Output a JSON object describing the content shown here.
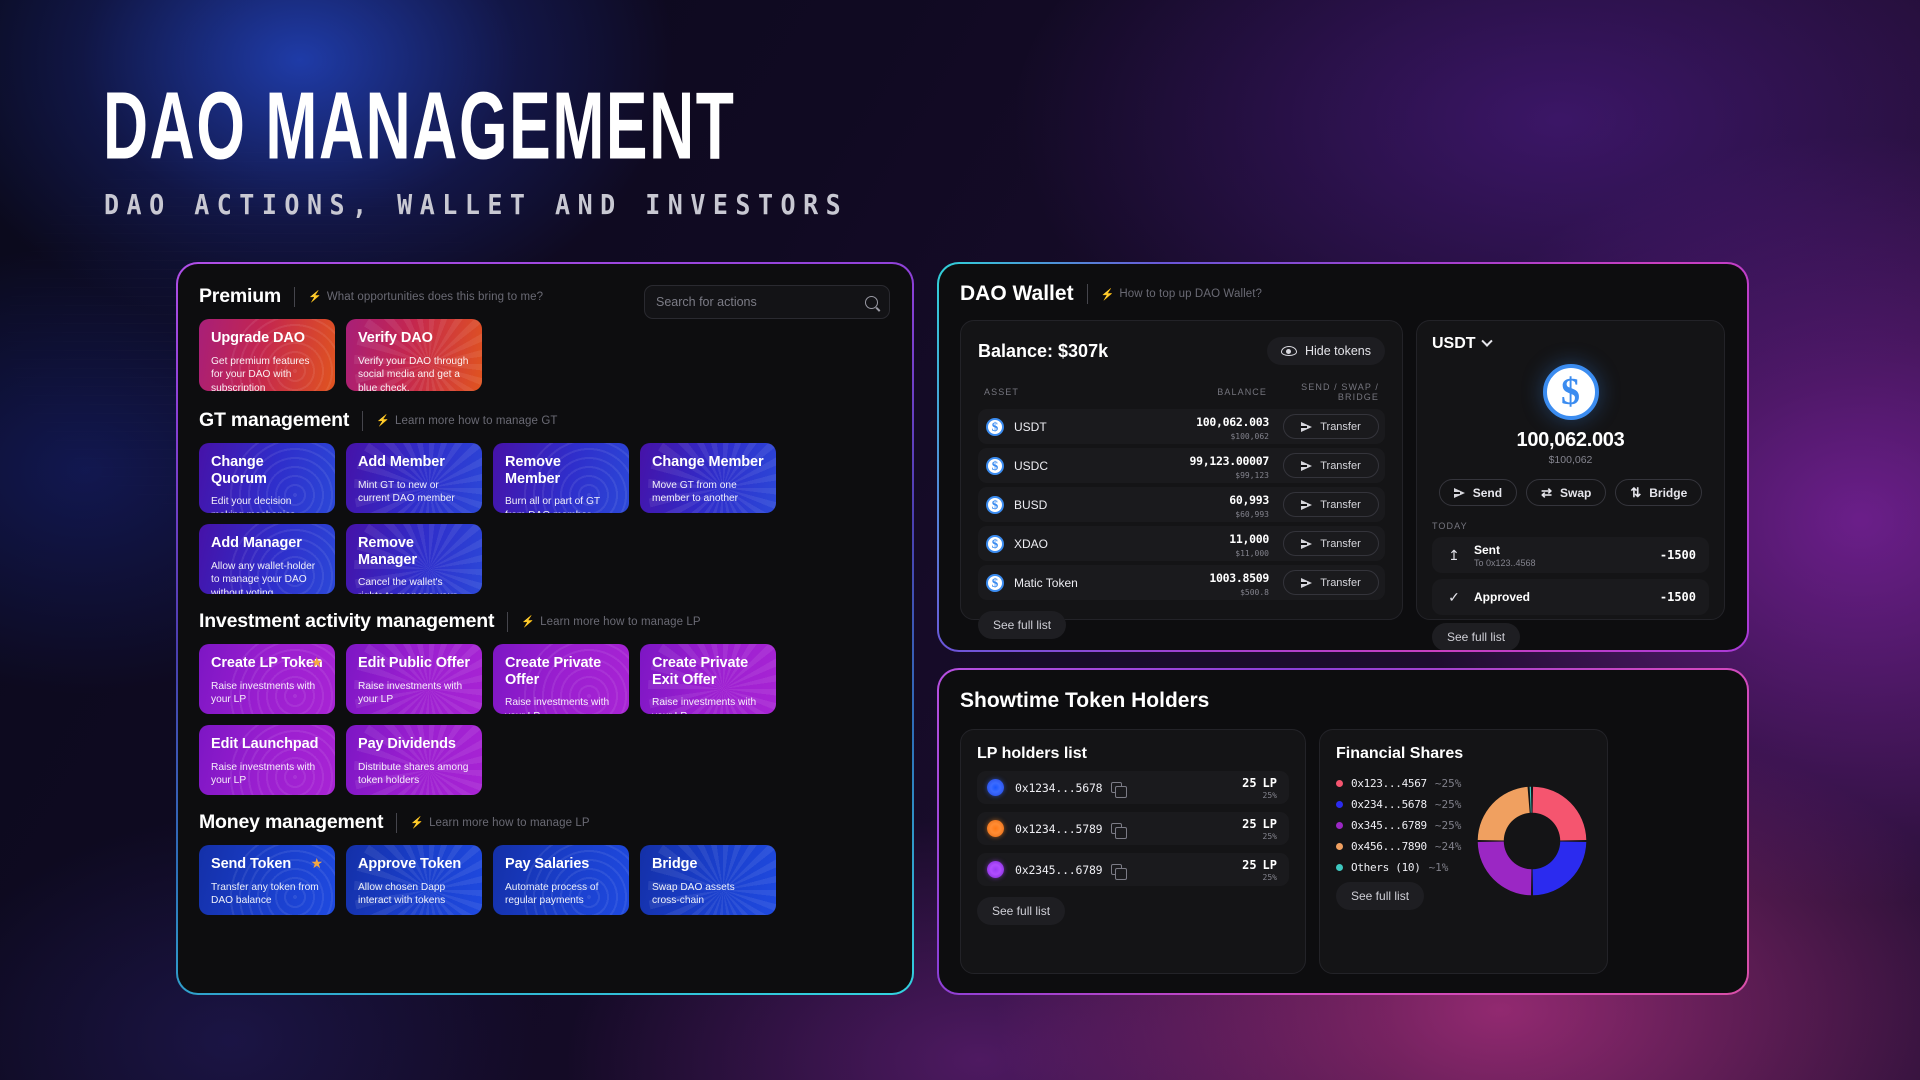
{
  "header": {
    "title": "DAO MANAGEMENT",
    "subtitle": "DAO ACTIONS, WALLET AND INVESTORS"
  },
  "search": {
    "placeholder": "Search for actions"
  },
  "left_panel": {
    "sections": [
      {
        "title": "Premium",
        "hint": "What opportunities does this bring to me?",
        "style": "premium",
        "cards": [
          {
            "title": "Upgrade DAO",
            "desc": "Get premium features for your DAO with subscription",
            "star": false
          },
          {
            "title": "Verify DAO",
            "desc": "Verify your DAO through social media and get a blue check.",
            "star": false
          }
        ]
      },
      {
        "title": "GT management",
        "hint": "Learn more how to manage GT",
        "style": "gt",
        "cards": [
          {
            "title": "Change Quorum",
            "desc": "Edit your decision making mechanics",
            "star": false
          },
          {
            "title": "Add Member",
            "desc": "Mint GT to new or current DAO member",
            "star": false
          },
          {
            "title": "Remove Member",
            "desc": "Burn all or part of GT from DAO member",
            "star": false
          },
          {
            "title": "Change Member",
            "desc": "Move GT from one member to another",
            "star": false
          },
          {
            "title": "Add Manager",
            "desc": "Allow any wallet-holder to manage your DAO without voting",
            "star": false
          },
          {
            "title": "Remove Manager",
            "desc": "Cancel the wallet's rights to manage your DAO",
            "star": false
          }
        ]
      },
      {
        "title": "Investment activity management",
        "hint": "Learn more how to manage LP",
        "style": "inv",
        "cards": [
          {
            "title": "Create LP Token",
            "desc": "Raise investments with your LP",
            "star": true
          },
          {
            "title": "Edit Public Offer",
            "desc": "Raise investments with your LP",
            "star": false
          },
          {
            "title": "Create Private Offer",
            "desc": "Raise investments with your LP",
            "star": false
          },
          {
            "title": "Create Private Exit Offer",
            "desc": "Raise investments with your LP",
            "star": false
          },
          {
            "title": "Edit Launchpad",
            "desc": "Raise investments with your LP",
            "star": false
          },
          {
            "title": "Pay Dividends",
            "desc": "Distribute shares among token holders",
            "star": false
          }
        ]
      },
      {
        "title": "Money management",
        "hint": "Learn more how to manage LP",
        "style": "money",
        "cards": [
          {
            "title": "Send Token",
            "desc": "Transfer any token from DAO balance",
            "star": true
          },
          {
            "title": "Approve Token",
            "desc": "Allow chosen Dapp interact with tokens",
            "star": false
          },
          {
            "title": "Pay Salaries",
            "desc": "Automate process of regular payments",
            "star": false
          },
          {
            "title": "Bridge",
            "desc": "Swap DAO assets cross-chain",
            "star": false
          }
        ]
      }
    ]
  },
  "wallet": {
    "title": "DAO Wallet",
    "hint": "How to top up DAO Wallet?",
    "balance_label": "Balance: $307k",
    "hide_tokens_label": "Hide tokens",
    "columns": {
      "asset": "ASSET",
      "balance": "BALANCE",
      "action": "SEND / SWAP / BRIDGE"
    },
    "transfer_label": "Transfer",
    "see_full_list": "See full list",
    "assets": [
      {
        "name": "USDT",
        "amount": "100,062.003",
        "usd": "$100,062"
      },
      {
        "name": "USDC",
        "amount": "99,123.00007",
        "usd": "$99,123"
      },
      {
        "name": "BUSD",
        "amount": "60,993",
        "usd": "$60,993"
      },
      {
        "name": "XDAO",
        "amount": "11,000",
        "usd": "$11,000"
      },
      {
        "name": "Matic Token",
        "amount": "1003.8509",
        "usd": "$500.8"
      }
    ],
    "detail": {
      "selected_token": "USDT",
      "amount": "100,062.003",
      "usd": "$100,062",
      "buttons": {
        "send": "Send",
        "swap": "Swap",
        "bridge": "Bridge"
      },
      "today_label": "TODAY",
      "see_full_list": "See full list",
      "transactions": [
        {
          "icon": "upload-icon",
          "title": "Sent",
          "sub": "To 0x123..4568",
          "amount": "-1500"
        },
        {
          "icon": "check-icon",
          "title": "Approved",
          "sub": "",
          "amount": "-1500"
        }
      ]
    }
  },
  "holders": {
    "title": "Showtime Token Holders",
    "lp": {
      "title": "LP holders list",
      "see_full_list": "See full list",
      "rows": [
        {
          "address": "0x1234...5678",
          "amount": "25",
          "unit": "LP",
          "pct": "25%",
          "avatar": "blue"
        },
        {
          "address": "0x1234...5789",
          "amount": "25",
          "unit": "LP",
          "pct": "25%",
          "avatar": "orange"
        },
        {
          "address": "0x2345...6789",
          "amount": "25",
          "unit": "LP",
          "pct": "25%",
          "avatar": "purple"
        }
      ]
    },
    "financial": {
      "title": "Financial Shares",
      "see_full_list": "See full list"
    }
  },
  "chart_data": {
    "type": "pie",
    "title": "Financial Shares",
    "legend_position": "left",
    "labels": [
      "0x123...4567",
      "0x234...5678",
      "0x345...6789",
      "0x456...7890",
      "Others (10)"
    ],
    "display_values": [
      "~25%",
      "~25%",
      "~25%",
      "~24%",
      "~1%"
    ],
    "values": [
      25,
      25,
      25,
      24,
      1
    ],
    "colors": [
      "#f5556f",
      "#2b2bef",
      "#9b27c4",
      "#f0a060",
      "#3ec8c0"
    ],
    "donut": true,
    "hole_ratio": 0.52
  }
}
